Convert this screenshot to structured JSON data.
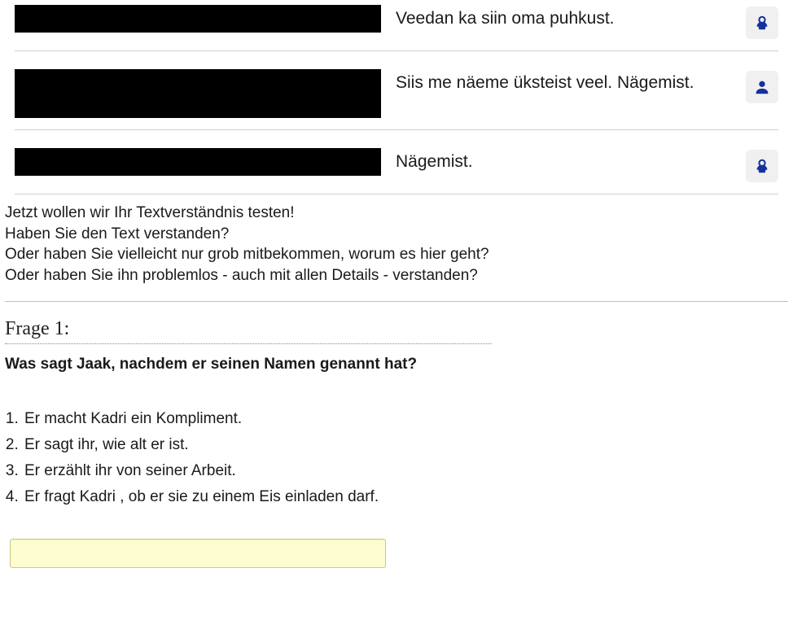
{
  "dialog": [
    {
      "text": "Veedan ka siin oma puhkust.",
      "speaker": "female",
      "tall": false,
      "justify": false
    },
    {
      "text": "Siis me näeme üksteist veel. Nägemist.",
      "speaker": "male",
      "tall": true,
      "justify": true
    },
    {
      "text": "Nägemist.",
      "speaker": "female",
      "tall": false,
      "justify": false
    }
  ],
  "intro": [
    "Jetzt wollen wir Ihr Textverständnis testen!",
    "Haben Sie den Text verstanden?",
    "Oder haben Sie vielleicht nur grob mitbekommen, worum es hier geht?",
    "Oder haben Sie ihn problemlos - auch mit allen Details - verstanden?"
  ],
  "question": {
    "title": "Frage 1:",
    "prompt": "Was sagt Jaak, nachdem er seinen Namen genannt hat?",
    "choices": [
      "Er macht Kadri ein Kompliment.",
      "Er sagt ihr, wie alt er ist.",
      "Er erzählt ihr von seiner Arbeit.",
      "Er fragt Kadri , ob er sie zu einem Eis einladen darf."
    ],
    "answer_value": ""
  }
}
